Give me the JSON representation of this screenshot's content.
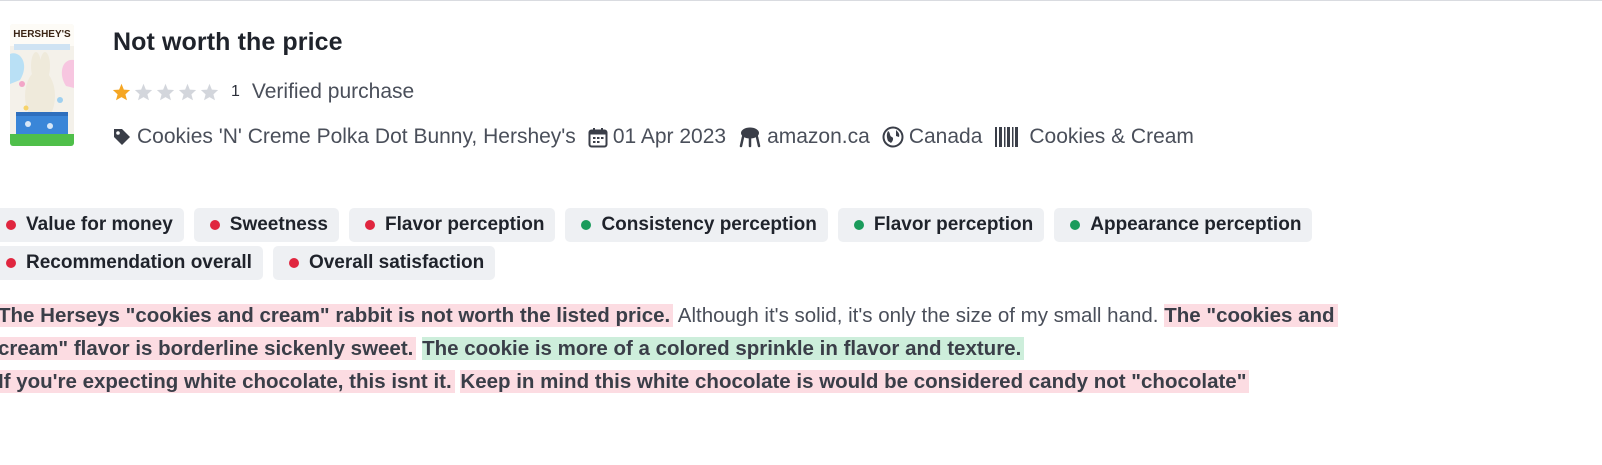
{
  "review": {
    "title": "Not worth the price",
    "rating": 1,
    "rating_max": 5,
    "rating_count": "1",
    "verified_label": "Verified purchase",
    "product_image_text": "HERSHEY'S",
    "meta": {
      "product": "Cookies 'N' Creme Polka Dot Bunny, Hershey's",
      "date": "01 Apr 2023",
      "source": "amazon.ca",
      "country": "Canada",
      "flavor": "Cookies & Cream"
    },
    "icons": {
      "product": "tag-icon",
      "date": "calendar-icon",
      "source": "store-icon",
      "country": "globe-icon",
      "flavor": "barcode-icon"
    },
    "tags_row1": [
      {
        "label": "Value for money",
        "sentiment": "negative"
      },
      {
        "label": "Sweetness",
        "sentiment": "negative"
      },
      {
        "label": "Flavor perception",
        "sentiment": "negative"
      },
      {
        "label": "Consistency perception",
        "sentiment": "positive"
      },
      {
        "label": "Flavor perception",
        "sentiment": "positive"
      },
      {
        "label": "Appearance perception",
        "sentiment": "positive"
      }
    ],
    "tags_row2": [
      {
        "label": "Recommendation overall",
        "sentiment": "negative"
      },
      {
        "label": "Overall satisfaction",
        "sentiment": "negative"
      }
    ],
    "body": {
      "s1": "The Herseys \"cookies and cream\" rabbit is not worth the listed price.",
      "s2": "Although it's solid, it's only the size of my small hand.",
      "s3a": "The \"cookies and",
      "s3b": "cream\" flavor is borderline sickenly sweet.",
      "s4": "The cookie is more of a colored sprinkle in flavor and texture.",
      "s5": "If you're expecting white chocolate, this isnt it.",
      "s6": "Keep in mind this white chocolate is would be considered candy not \"chocolate\""
    },
    "colors": {
      "negative": "#e0263f",
      "positive": "#1a9b5b",
      "highlight_negative": "#fcdce2",
      "highlight_positive": "#cdeedb",
      "star_filled": "#f5a623",
      "star_empty": "#d3d6dc"
    }
  }
}
